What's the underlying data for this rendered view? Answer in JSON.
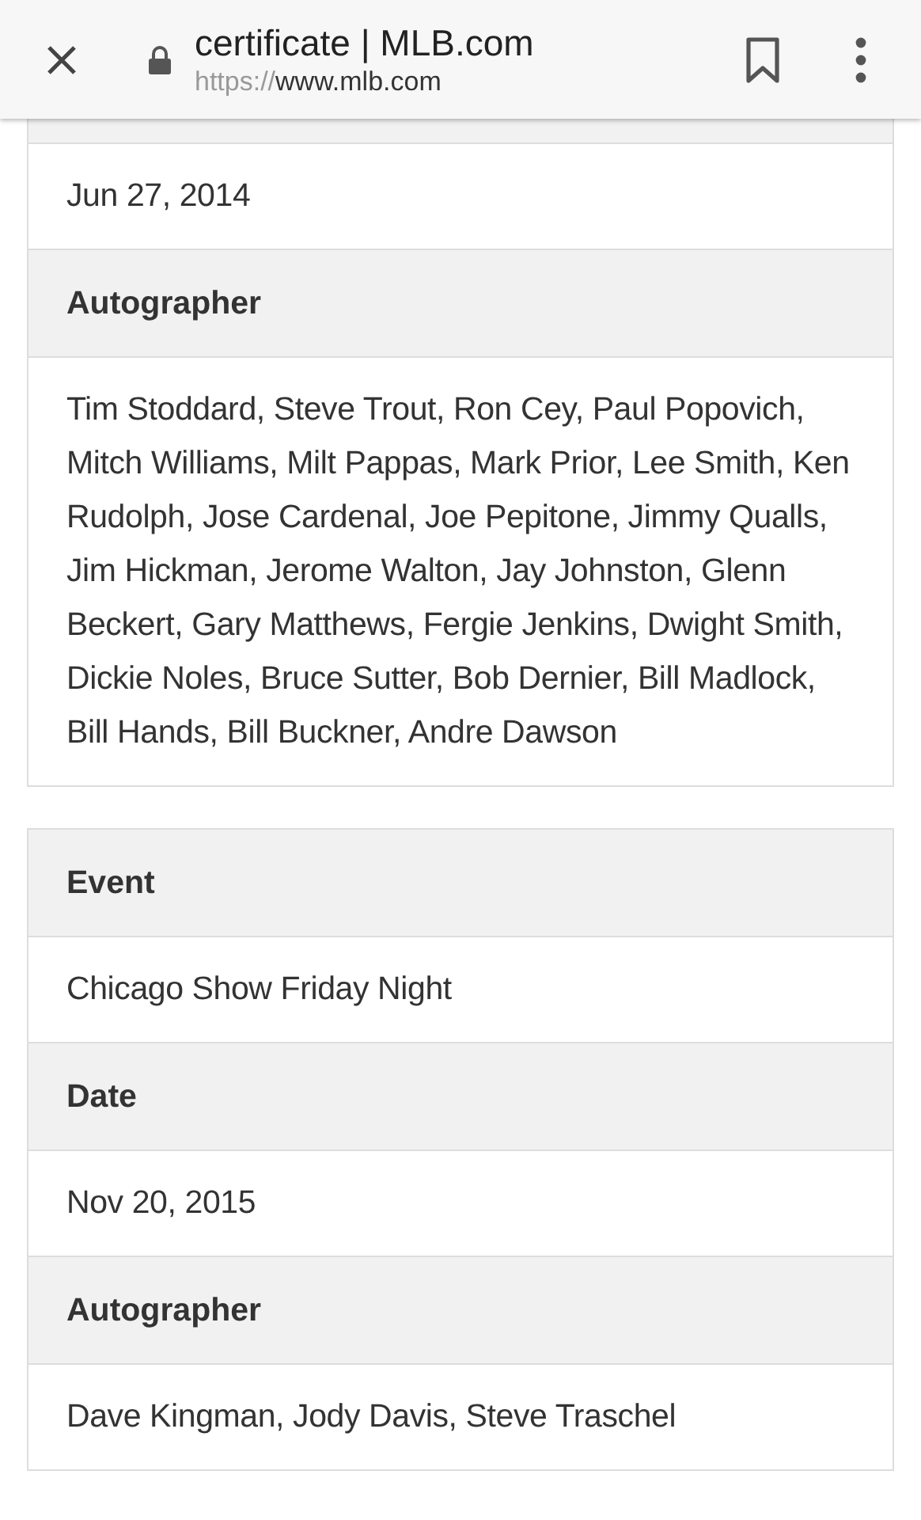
{
  "toolbar": {
    "title": "certificate | MLB.com",
    "url_scheme": "https://",
    "url_host": "www.mlb.com"
  },
  "cards": [
    {
      "rows": [
        {
          "kind": "header_cut"
        },
        {
          "kind": "value",
          "text": "Jun 27, 2014"
        },
        {
          "kind": "header",
          "text": "Autographer"
        },
        {
          "kind": "value",
          "text": "Tim Stoddard, Steve Trout, Ron Cey, Paul Popovich, Mitch Williams, Milt Pappas, Mark Prior, Lee Smith, Ken Rudolph, Jose Cardenal, Joe Pepitone, Jimmy Qualls, Jim Hickman, Jerome Walton, Jay Johnston, Glenn Beckert, Gary Matthews, Fergie Jenkins, Dwight Smith, Dickie Noles, Bruce Sutter, Bob Dernier, Bill Madlock, Bill Hands, Bill Buckner, Andre Dawson"
        }
      ]
    },
    {
      "rows": [
        {
          "kind": "header",
          "text": "Event"
        },
        {
          "kind": "value",
          "text": "Chicago Show Friday Night"
        },
        {
          "kind": "header",
          "text": "Date"
        },
        {
          "kind": "value",
          "text": "Nov 20, 2015"
        },
        {
          "kind": "header",
          "text": "Autographer"
        },
        {
          "kind": "value",
          "text": "Dave Kingman, Jody Davis, Steve Traschel"
        }
      ]
    }
  ]
}
